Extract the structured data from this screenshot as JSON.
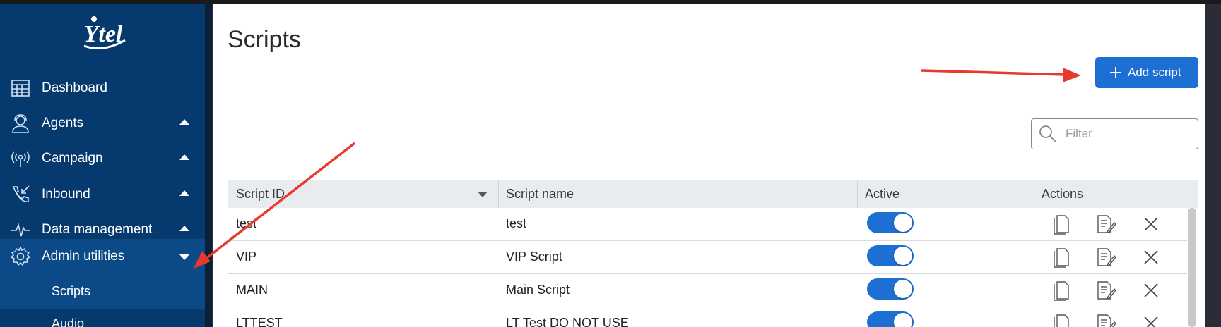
{
  "sidebar": {
    "logo_text": "Ytel",
    "items": [
      {
        "label": "Dashboard",
        "icon": "dashboard-grid-icon"
      },
      {
        "label": "Agents",
        "icon": "agent-headset-icon",
        "caret": "up"
      },
      {
        "label": "Campaign",
        "icon": "broadcast-icon",
        "caret": "up"
      },
      {
        "label": "Inbound",
        "icon": "phone-incoming-icon",
        "caret": "up"
      },
      {
        "label": "Data management",
        "icon": "pulse-icon",
        "caret": "up"
      },
      {
        "label": "Admin utilities",
        "icon": "gear-icon",
        "caret": "down"
      }
    ],
    "sub_items": [
      {
        "label": "Scripts"
      },
      {
        "label": "Audio"
      }
    ]
  },
  "main": {
    "title": "Scripts",
    "add_button_label": "Add script",
    "filter_placeholder": "Filter"
  },
  "table": {
    "columns": [
      "Script ID",
      "Script name",
      "Active",
      "Actions"
    ],
    "rows": [
      {
        "id": "test",
        "name": "test",
        "active": true
      },
      {
        "id": "VIP",
        "name": "VIP Script",
        "active": true
      },
      {
        "id": "MAIN",
        "name": "Main Script",
        "active": true
      },
      {
        "id": "LTTEST",
        "name": "LT Test DO NOT USE",
        "active": true
      }
    ]
  },
  "colors": {
    "sidebar": "#063a6e",
    "sidebar_active": "#0b4a86",
    "accent": "#1e6fd4",
    "annotation_arrow": "#e8392e"
  }
}
